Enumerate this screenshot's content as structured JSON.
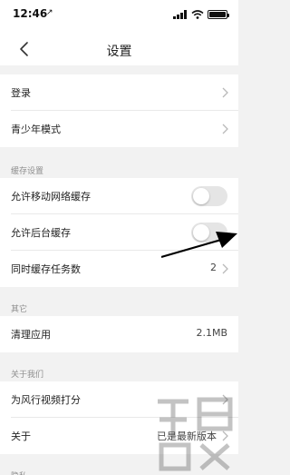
{
  "status_bar": {
    "time": "12:46",
    "location_glyph": "↗"
  },
  "nav": {
    "title": "设置"
  },
  "rows": {
    "login": {
      "label": "登录"
    },
    "teen_mode": {
      "label": "青少年模式"
    },
    "mobile_cache": {
      "label": "允许移动网络缓存",
      "enabled": false
    },
    "background_cache": {
      "label": "允许后台缓存",
      "enabled": false
    },
    "concurrent_tasks": {
      "label": "同时缓存任务数",
      "value": "2"
    },
    "clear_app": {
      "label": "清理应用",
      "value": "2.1MB"
    },
    "rate_app": {
      "label": "为风行视频打分"
    },
    "about": {
      "label": "关于",
      "value": "已是最新版本"
    }
  },
  "sections": {
    "cache": "缓存设置",
    "other": "其它",
    "about_us": "关于我们",
    "privacy": "隐私"
  },
  "colors": {
    "background": "#f2f2f2",
    "toggle_off": "#e5e5e5",
    "section_text": "#8e8e8e"
  }
}
